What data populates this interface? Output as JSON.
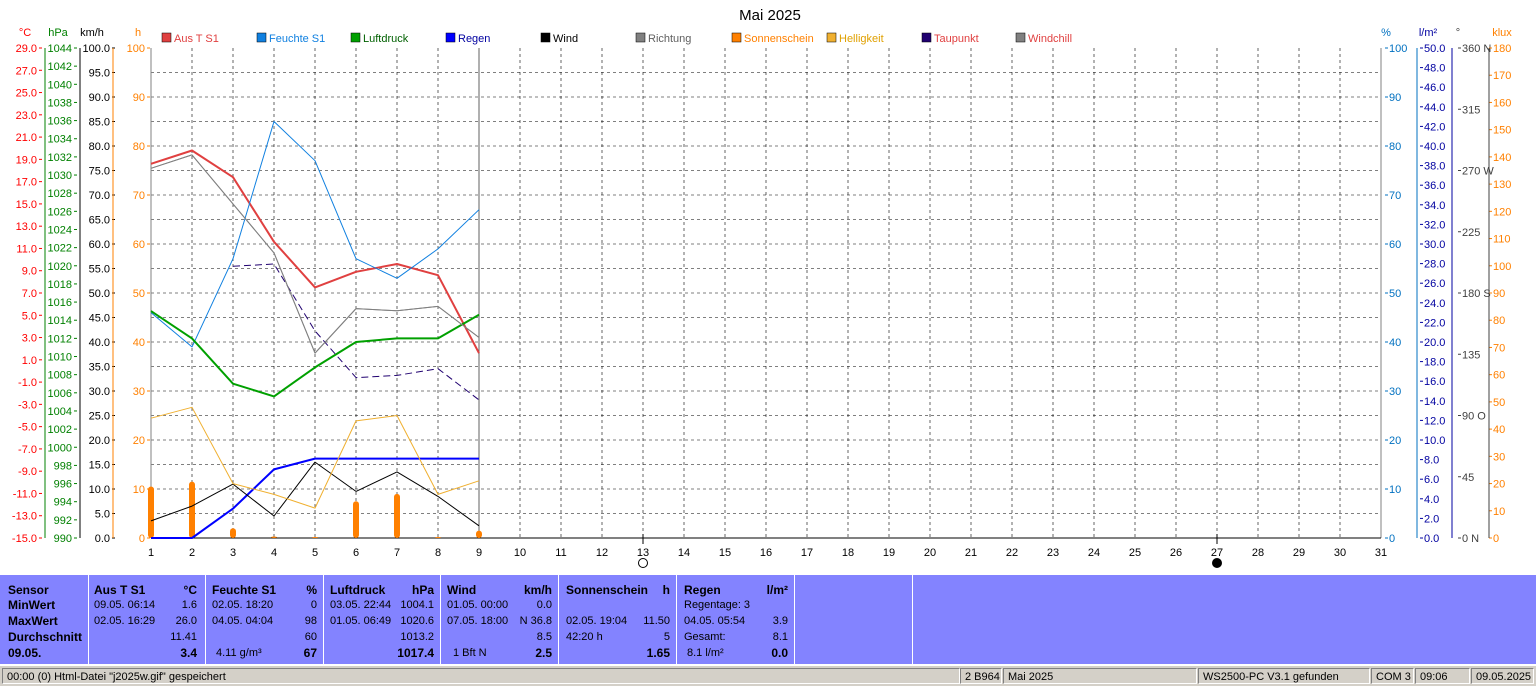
{
  "chart_data": {
    "type": "line",
    "title": "Mai 2025",
    "x": [
      1,
      2,
      3,
      4,
      5,
      6,
      7,
      8,
      9
    ],
    "x_ticks": [
      "1",
      "2",
      "3",
      "4",
      "5",
      "6",
      "7",
      "8",
      "9",
      "10",
      "11",
      "12",
      "13",
      "14",
      "15",
      "16",
      "17",
      "18",
      "19",
      "20",
      "21",
      "22",
      "23",
      "24",
      "25",
      "26",
      "27",
      "28",
      "29",
      "30",
      "31"
    ],
    "xlim": [
      1,
      31
    ],
    "axes": {
      "temp": {
        "unit": "°C",
        "color": "#ff0000",
        "ticks": [
          "29.0",
          "27.0",
          "25.0",
          "23.0",
          "21.0",
          "19.0",
          "17.0",
          "15.0",
          "13.0",
          "11.0",
          "9.0",
          "7.0",
          "5.0",
          "3.0",
          "1.0",
          "-1.0",
          "-3.0",
          "-5.0",
          "-7.0",
          "-9.0",
          "-11.0",
          "-13.0",
          "-15.0"
        ],
        "range": [
          -15,
          29
        ]
      },
      "pressure": {
        "unit": "hPa",
        "color": "#008000",
        "ticks": [
          "1044",
          "1042",
          "1040",
          "1038",
          "1036",
          "1034",
          "1032",
          "1030",
          "1028",
          "1026",
          "1024",
          "1022",
          "1020",
          "1018",
          "1016",
          "1014",
          "1012",
          "1010",
          "1008",
          "1006",
          "1004",
          "1002",
          "1000",
          "998",
          "996",
          "994",
          "992",
          "990"
        ],
        "range": [
          990,
          1044
        ]
      },
      "wind": {
        "unit": "km/h",
        "color": "#000000",
        "ticks": [
          "100.0",
          "95.0",
          "90.0",
          "85.0",
          "80.0",
          "75.0",
          "70.0",
          "65.0",
          "60.0",
          "55.0",
          "50.0",
          "45.0",
          "40.0",
          "35.0",
          "30.0",
          "25.0",
          "20.0",
          "15.0",
          "10.0",
          "5.0",
          "0.0"
        ],
        "range": [
          0,
          100
        ]
      },
      "sun": {
        "unit": "h",
        "color": "#ff8000",
        "ticks": [
          "100",
          "90",
          "80",
          "70",
          "60",
          "50",
          "40",
          "30",
          "20",
          "10",
          "0"
        ],
        "range": [
          0,
          100
        ]
      },
      "humidity": {
        "unit": "%",
        "color": "#0070c0",
        "ticks": [
          "100",
          "90",
          "80",
          "70",
          "60",
          "50",
          "40",
          "30",
          "20",
          "10",
          "0"
        ],
        "range": [
          0,
          100
        ]
      },
      "rain": {
        "unit": "l/m²",
        "color": "#0000a0",
        "ticks": [
          "50.0",
          "48.0",
          "46.0",
          "44.0",
          "42.0",
          "40.0",
          "38.0",
          "36.0",
          "34.0",
          "32.0",
          "30.0",
          "28.0",
          "26.0",
          "24.0",
          "22.0",
          "20.0",
          "18.0",
          "16.0",
          "14.0",
          "12.0",
          "10.0",
          "8.0",
          "6.0",
          "4.0",
          "2.0",
          "0.0"
        ],
        "range": [
          0,
          50
        ]
      },
      "direction": {
        "unit": "°",
        "color": "#404040",
        "ticks": [
          "360 N",
          "315",
          "270 W",
          "225",
          "180 S",
          "135",
          "90 O",
          "45",
          "0 N"
        ],
        "range": [
          0,
          360
        ]
      },
      "lux": {
        "unit": "klux",
        "color": "#ff8000",
        "ticks": [
          "180",
          "170",
          "160",
          "150",
          "140",
          "130",
          "120",
          "110",
          "100",
          "90",
          "80",
          "70",
          "60",
          "50",
          "40",
          "30",
          "20",
          "10",
          "0"
        ],
        "range": [
          0,
          180
        ]
      }
    },
    "series": [
      {
        "name": "Aus T S1",
        "color": "#e04040",
        "axis": "temp",
        "width": 2,
        "values": [
          18.6,
          19.8,
          17.4,
          11.6,
          7.5,
          8.9,
          9.6,
          8.6,
          1.6
        ]
      },
      {
        "name": "Feuchte S1",
        "color": "#1080e0",
        "axis": "humidity",
        "width": 1,
        "values": [
          46,
          39,
          57,
          85,
          77,
          57,
          53,
          59,
          67
        ]
      },
      {
        "name": "Luftdruck",
        "color": "#00a000",
        "axis": "pressure",
        "width": 2,
        "values": [
          1015.0,
          1012.0,
          1007.0,
          1005.6,
          1008.8,
          1011.6,
          1012.0,
          1012.0,
          1014.6
        ]
      },
      {
        "name": "Regen",
        "color": "#0000ff",
        "axis": "rain",
        "width": 2,
        "values": [
          0.0,
          0.0,
          3.0,
          7.0,
          8.1,
          8.1,
          8.1,
          8.1,
          8.1
        ]
      },
      {
        "name": "Wind",
        "color": "#000000",
        "axis": "wind",
        "width": 1,
        "values": [
          3.5,
          6.5,
          11.0,
          4.5,
          15.5,
          9.5,
          13.5,
          8.5,
          2.5
        ]
      },
      {
        "name": "Richtung",
        "color": "#808080",
        "axis": "temp",
        "width": 1,
        "values": [
          18.2,
          19.4,
          15.0,
          10.6,
          1.6,
          5.6,
          5.4,
          5.8,
          3.0
        ]
      },
      {
        "name": "Helligkeit",
        "color": "#f0b030",
        "axis": "lux",
        "width": 1,
        "values": [
          44,
          48,
          20,
          16,
          11,
          43,
          45,
          16,
          21
        ]
      },
      {
        "name": "Taupunkt",
        "color": "#200070",
        "axis": "temp",
        "width": 1,
        "dash": true,
        "values": [
          5.8,
          null,
          9.4,
          9.6,
          3.6,
          -0.6,
          -0.4,
          0.2,
          -2.6
        ]
      },
      {
        "name": "Windchill",
        "color": "#808080",
        "axis": "temp",
        "width": 1,
        "values": [
          18.2,
          19.4,
          15.0,
          10.6,
          1.6,
          5.6,
          5.4,
          5.8,
          3.0
        ]
      }
    ],
    "sunshine_bars": {
      "name": "Sonnenschein",
      "color": "#ff8000",
      "axis": "sun",
      "values": [
        10.5,
        11.5,
        2.0,
        0.3,
        0.2,
        7.5,
        9.0,
        0.2,
        1.5
      ]
    },
    "legend": [
      {
        "label": "Aus T S1",
        "color": "#e04040",
        "text_color": "#e04040"
      },
      {
        "label": "Feuchte S1",
        "color": "#1080e0",
        "text_color": "#1080e0"
      },
      {
        "label": "Luftdruck",
        "color": "#00a000",
        "text_color": "#006000"
      },
      {
        "label": "Regen",
        "color": "#0000ff",
        "text_color": "#0000a0"
      },
      {
        "label": "Wind",
        "color": "#000000",
        "text_color": "#000000"
      },
      {
        "label": "Richtung",
        "color": "#808080",
        "text_color": "#606060"
      },
      {
        "label": "Sonnenschein",
        "color": "#ff8000",
        "text_color": "#ff8000"
      },
      {
        "label": "Helligkeit",
        "color": "#f0b030",
        "text_color": "#e0a000"
      },
      {
        "label": "Taupunkt",
        "color": "#200070",
        "text_color": "#e04040"
      },
      {
        "label": "Windchill",
        "color": "#808080",
        "text_color": "#e04040"
      }
    ],
    "moon_phases": [
      {
        "day": 13,
        "phase": "full"
      },
      {
        "day": 27,
        "phase": "new"
      }
    ],
    "grid": true,
    "legend_position": "top"
  },
  "stats": {
    "labels": [
      "Sensor",
      "MinWert",
      "MaxWert",
      "Durchschnitt",
      "09.05."
    ],
    "temp": {
      "title": "Aus T S1",
      "unit": "°C",
      "min_time": "09.05.  06:14",
      "min": "1.6",
      "max_time": "02.05.  16:29",
      "max": "26.0",
      "avg": "11.41",
      "current": "3.4"
    },
    "humidity": {
      "title": "Feuchte S1",
      "unit": "%",
      "min_time": "02.05.  18:20",
      "min": "0",
      "max_time": "04.05.  04:04",
      "max": "98",
      "avg": "60",
      "abs": "4.11 g/m³",
      "current": "67"
    },
    "pressure": {
      "title": "Luftdruck",
      "unit": "hPa",
      "min_time": "03.05.  22:44",
      "min": "1004.1",
      "max_time": "01.05.  06:49",
      "max": "1020.6",
      "avg": "1013.2",
      "current": "1017.4"
    },
    "wind": {
      "title": "Wind",
      "unit": "km/h",
      "min_time": "01.05.  00:00",
      "min": "0.0",
      "max_time": "07.05.  18:00",
      "max": "N 36.8",
      "avg": "8.5",
      "bft": "1 Bft N",
      "current": "2.5"
    },
    "sun": {
      "title": "Sonnenschein",
      "unit": "h",
      "max_time": "02.05.  19:04",
      "max": "11.50",
      "avg_time": "42:20 h",
      "avg": "5",
      "current": "1.65"
    },
    "rain": {
      "title": "Regen",
      "unit": "l/m²",
      "days": "Regentage: 3",
      "max_time": "04.05.  05:54",
      "max": "3.9",
      "total_label": "Gesamt:",
      "total": "8.1",
      "month_total": "8.1 l/m²",
      "current": "0.0"
    }
  },
  "status": {
    "left": "00:00  (0)  Html-Datei  \"j2025w.gif\"  gespeichert",
    "code": "2 B964",
    "month": "Mai 2025",
    "device": "WS2500-PC V3.1 gefunden",
    "port": "COM 3",
    "time": "09:06",
    "date": "09.05.2025"
  }
}
